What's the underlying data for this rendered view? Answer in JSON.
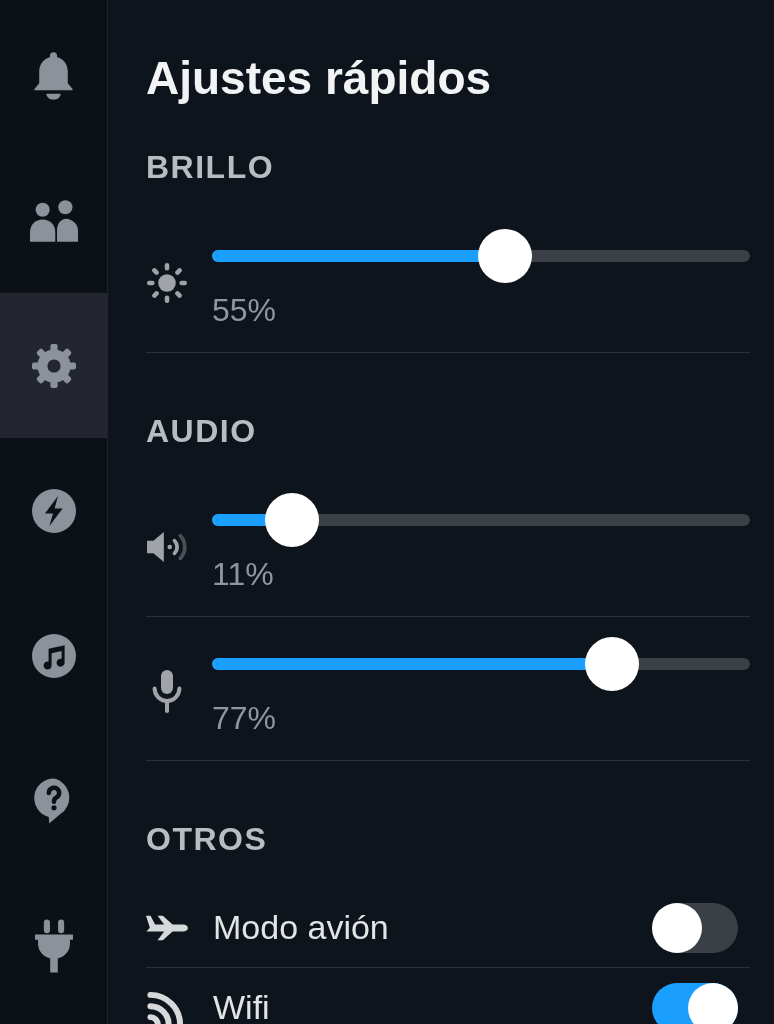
{
  "sidebar": {
    "items": [
      {
        "kind": "notifications",
        "selected": false
      },
      {
        "kind": "friends",
        "selected": false
      },
      {
        "kind": "settings",
        "selected": true
      },
      {
        "kind": "performance",
        "selected": false
      },
      {
        "kind": "music",
        "selected": false
      },
      {
        "kind": "help",
        "selected": false
      },
      {
        "kind": "power",
        "selected": false
      }
    ]
  },
  "panel": {
    "title": "Ajustes rápidos",
    "sections": [
      {
        "heading": "BRILLO",
        "controls": [
          {
            "kind": "brightness",
            "level": 0.55,
            "reading": "55%"
          }
        ]
      },
      {
        "heading": "AUDIO",
        "controls": [
          {
            "kind": "volume",
            "level": 0.11,
            "reading": "11%"
          },
          {
            "kind": "microphone",
            "level": 0.77,
            "reading": "77%"
          }
        ]
      },
      {
        "heading": "OTROS",
        "controls": [
          {
            "kind": "airplane",
            "label": "Modo avión",
            "on": false
          },
          {
            "kind": "wifi",
            "label": "Wifi",
            "on": true
          }
        ]
      }
    ]
  }
}
